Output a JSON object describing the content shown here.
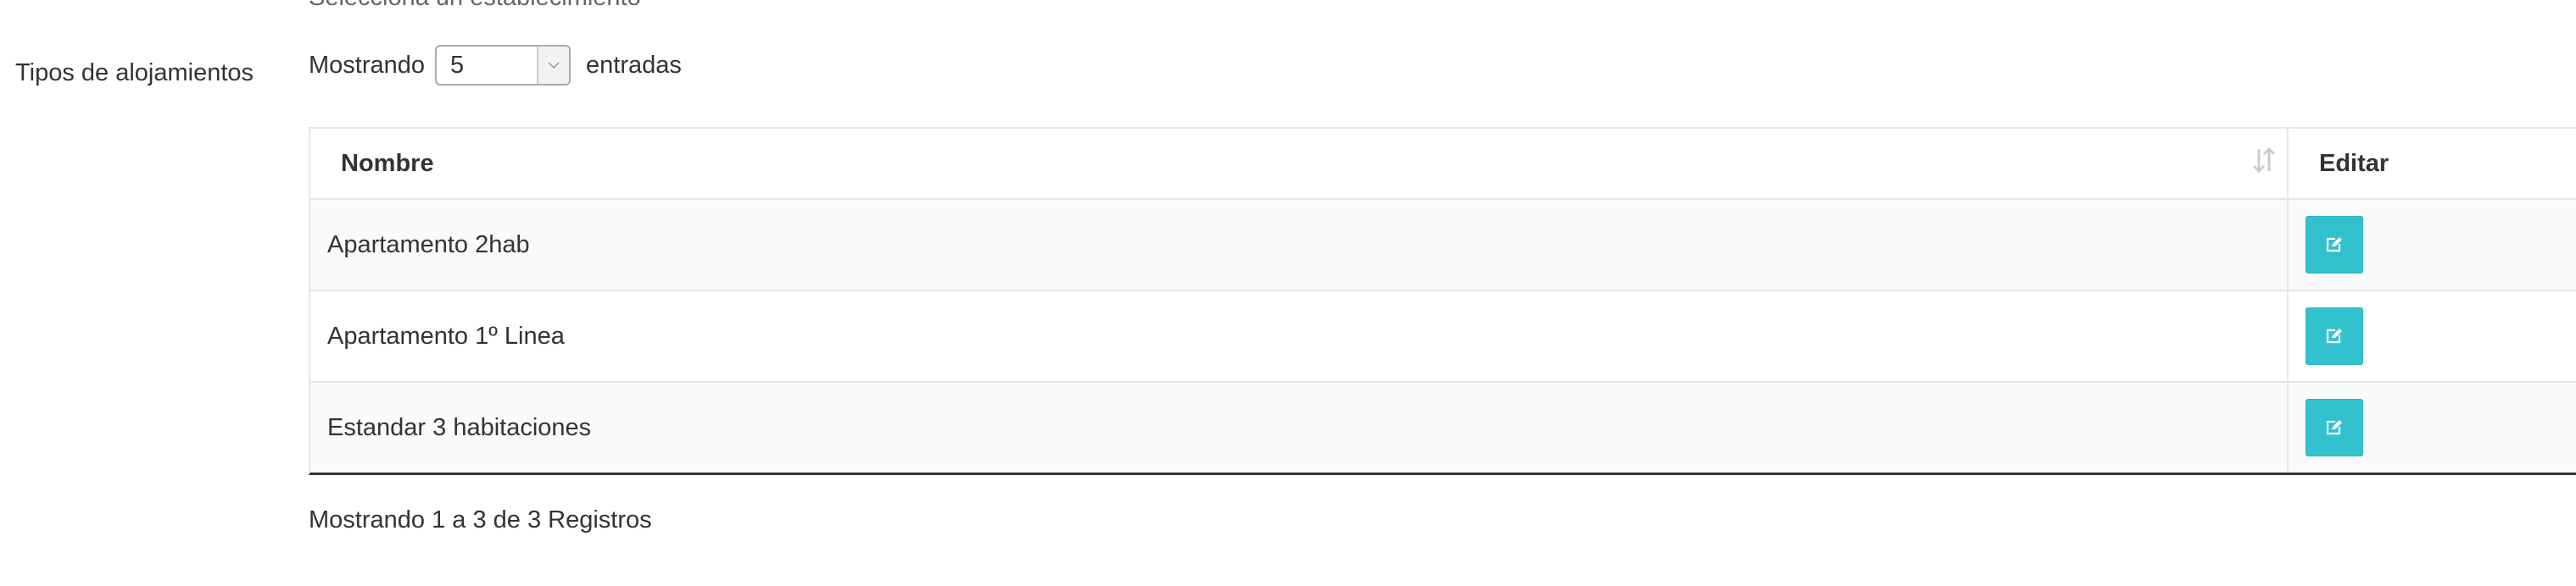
{
  "form": {
    "establishment_hint": "Selecciona un establecimiento",
    "field_label": "Tipos de alojamientos"
  },
  "length_control": {
    "prefix": "Mostrando",
    "selected": "5",
    "suffix": "entradas"
  },
  "table": {
    "columns": {
      "name": "Nombre",
      "edit": "Editar"
    },
    "rows": [
      {
        "name": "Apartamento 2hab"
      },
      {
        "name": "Apartamento 1º Linea"
      },
      {
        "name": "Estandar 3 habitaciones"
      }
    ]
  },
  "info_text": "Mostrando 1 a 3 de 3 Registros",
  "colors": {
    "edit_button": "#32c2cd",
    "row_stripe": "#f9fafb"
  },
  "icons": {
    "sort": "sort-icon",
    "edit": "edit-icon",
    "dropdown": "chevron-down-icon"
  }
}
